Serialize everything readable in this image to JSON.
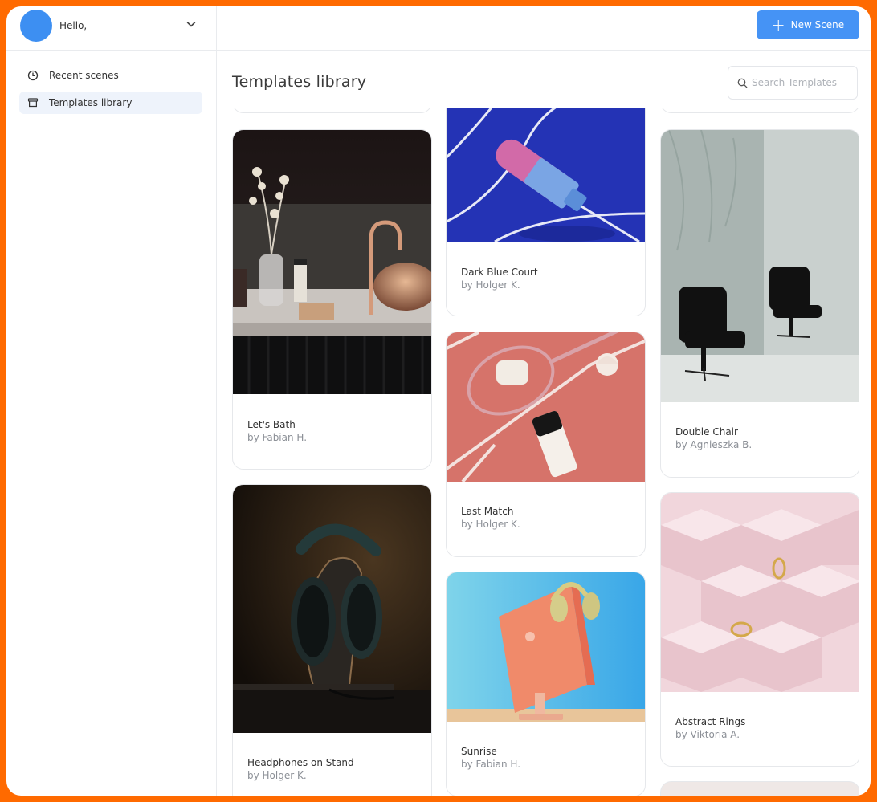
{
  "user": {
    "greeting": "Hello,"
  },
  "toolbar": {
    "new_scene_label": "New Scene"
  },
  "sidebar": {
    "items": [
      {
        "label": "Recent scenes",
        "icon": "clock-icon"
      },
      {
        "label": "Templates library",
        "icon": "archive-icon",
        "active": true
      }
    ]
  },
  "main": {
    "title": "Templates library",
    "search": {
      "placeholder": "Search Templates",
      "value": ""
    }
  },
  "templates": [
    {
      "name": "Let's Bath",
      "author": "by Fabian H."
    },
    {
      "name": "Headphones on Stand",
      "author": "by Holger K."
    },
    {
      "name": "Dark Blue Court",
      "author": "by Holger K."
    },
    {
      "name": "Last Match",
      "author": "by Holger K."
    },
    {
      "name": "Sunrise",
      "author": "by Fabian H."
    },
    {
      "name": "Double Chair",
      "author": "by Agnieszka B."
    },
    {
      "name": "Abstract Rings",
      "author": "by Viktoria A."
    }
  ],
  "colors": {
    "accent": "#4593f5",
    "avatar": "#3d8ff2",
    "frame": "#ff6a00"
  }
}
